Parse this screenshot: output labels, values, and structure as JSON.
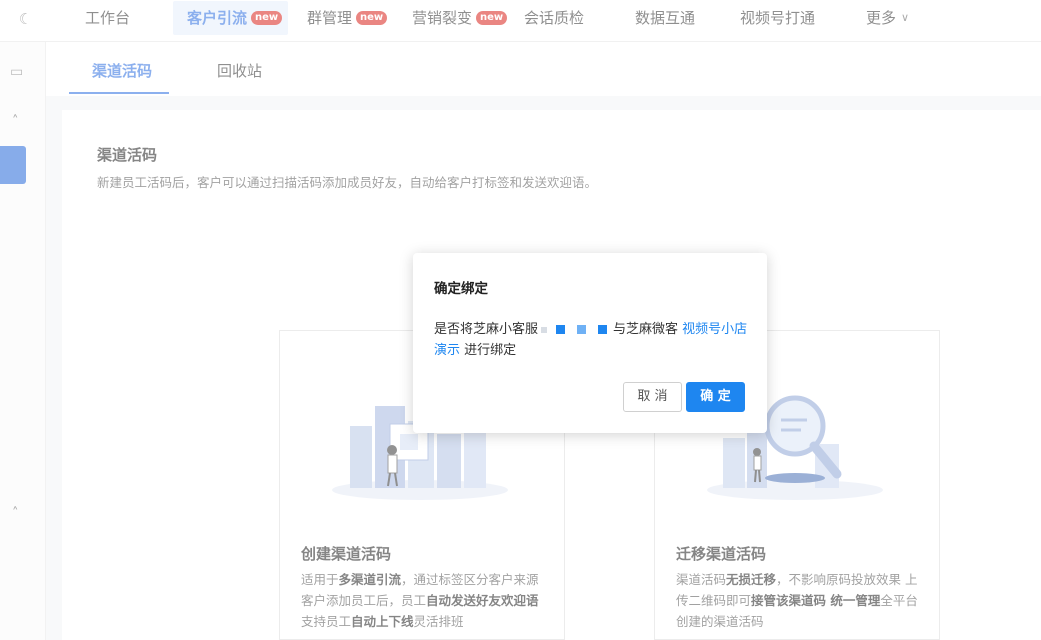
{
  "nav": {
    "items": [
      {
        "label": "工作台"
      },
      {
        "label": "客户引流",
        "badge": "new"
      },
      {
        "label": "群管理",
        "badge": "new"
      },
      {
        "label": "营销裂变",
        "badge": "new"
      },
      {
        "label": "会话质检"
      },
      {
        "label": "数据互通"
      },
      {
        "label": "视频号打通"
      },
      {
        "label": "更多"
      }
    ]
  },
  "subtabs": [
    {
      "label": "渠道活码"
    },
    {
      "label": "回收站"
    }
  ],
  "section": {
    "title": "渠道活码",
    "desc": "新建员工活码后，客户可以通过扫描活码添加成员好友，自动给客户打标签和发送欢迎语。"
  },
  "cards": [
    {
      "title": "创建渠道活码",
      "text": [
        {
          "t": "适用于",
          "b": false
        },
        {
          "t": "多渠道引流",
          "b": true
        },
        {
          "t": "，通过标签区分客户来源 客户添加员工后，员工",
          "b": false
        },
        {
          "t": "自动发送好友欢迎语",
          "b": true
        },
        {
          "t": " 支持员工",
          "b": false
        },
        {
          "t": "自动上下线",
          "b": true
        },
        {
          "t": "灵活排班",
          "b": false
        }
      ]
    },
    {
      "title": "迁移渠道活码",
      "text": [
        {
          "t": "渠道活码",
          "b": false
        },
        {
          "t": "无损迁移",
          "b": true
        },
        {
          "t": "，不影响原码投放效果 上传二维码即可",
          "b": false
        },
        {
          "t": "接管该渠道码 统一管理",
          "b": true
        },
        {
          "t": "全平台创建的渠道活码",
          "b": false
        }
      ]
    }
  ],
  "modal": {
    "title": "确定绑定",
    "text_prefix": "是否将芝麻小客服",
    "text_middle": "与芝麻微客",
    "link": "视频号小店演示",
    "text_suffix": " 进行绑定",
    "cancel": "取 消",
    "confirm": "确 定"
  },
  "colors": {
    "accent": "#1e86f0",
    "active_nav": "#2f6fe0",
    "badge": "#d9241c"
  }
}
